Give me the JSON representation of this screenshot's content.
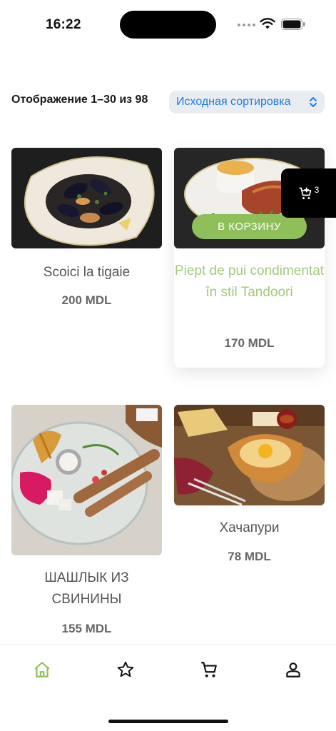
{
  "status_bar": {
    "time": "16:22"
  },
  "toolbar": {
    "result_count": "Отображение 1–30 из 98",
    "sort_selected": "Исходная сортировка"
  },
  "products": [
    {
      "name": "Scoici la tigaie",
      "price": "200 MDL"
    },
    {
      "name": "Piept de pui condimentat în stil Tandoori",
      "price": "170 MDL",
      "hover_button": "В КОРЗИНУ"
    },
    {
      "name": "ШАШЛЫК ИЗ СВИНИНЫ",
      "price": "155 MDL"
    },
    {
      "name": "Хачапури",
      "price": "78 MDL"
    }
  ],
  "floating_cart": {
    "count": "3",
    "icon": "cart-add-icon"
  },
  "bottom_nav": {
    "items": [
      {
        "icon": "home-icon",
        "active": true
      },
      {
        "icon": "star-icon"
      },
      {
        "icon": "cart-icon"
      },
      {
        "icon": "user-icon"
      }
    ]
  },
  "colors": {
    "accent_green": "#8fbf5a",
    "highlight_text": "#a4c97c",
    "link_blue": "#1c7be6"
  }
}
